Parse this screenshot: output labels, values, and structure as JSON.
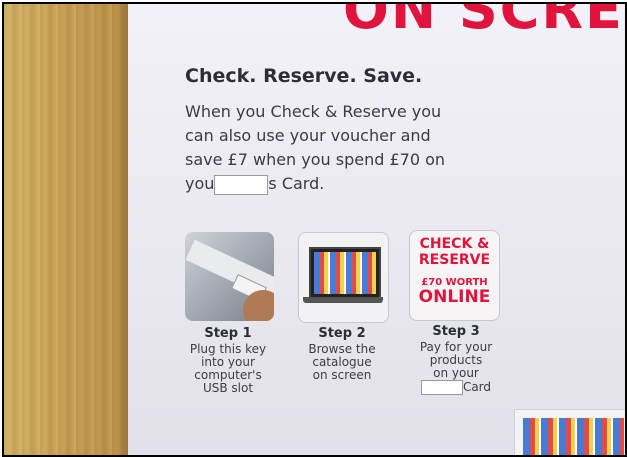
{
  "banner": {
    "text": "ON SCREE"
  },
  "headline": "Check. Reserve. Save.",
  "paragraph": {
    "line1": "When you Check & Reserve you",
    "line2": "can also use your voucher and",
    "line3": "save £7 when you spend £70 on",
    "line4_pre": "you",
    "line4_post": "s Card."
  },
  "steps": [
    {
      "title": "Step 1",
      "desc": [
        "Plug this key",
        "into your",
        "computer's",
        "USB slot"
      ]
    },
    {
      "title": "Step 2",
      "desc": [
        "Browse the",
        "catalogue",
        "on screen"
      ]
    },
    {
      "title": "Step 3",
      "desc": [
        "Pay for your",
        "products",
        "on your"
      ],
      "desc_tail": "Card"
    }
  ],
  "step3_badge": {
    "line1": "CHECK &",
    "line2": "RESERVE",
    "line3": "£70 WORTH",
    "line4": "ONLINE"
  },
  "colors": {
    "accent_red": "#e0143c",
    "text_dark": "#2b2e36"
  }
}
